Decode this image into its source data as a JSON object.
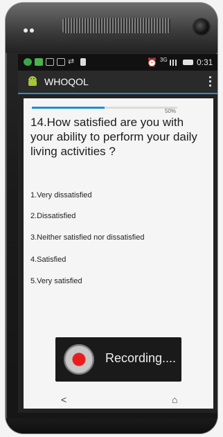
{
  "status_bar": {
    "time": "0:31",
    "network": "3G"
  },
  "app_bar": {
    "title": "WHOQOL"
  },
  "survey": {
    "progress_label": "50%",
    "progress_value": 0.5,
    "question": "14.How satisfied are you with your ability to perform your daily living activities ?",
    "options": [
      "1.Very dissatisfied",
      "2.Dissatisfied",
      "3.Neither satisfied nor dissatisfied",
      "4.Satisfied",
      "5.Very satisfied"
    ]
  },
  "recording": {
    "label": "Recording...."
  },
  "colors": {
    "accent": "#1d8fd1",
    "record": "#e81e1e"
  },
  "icons": {
    "back": "back-arrow-icon",
    "home": "home-icon",
    "menu": "overflow-menu-icon",
    "logo": "android-logo-icon"
  }
}
